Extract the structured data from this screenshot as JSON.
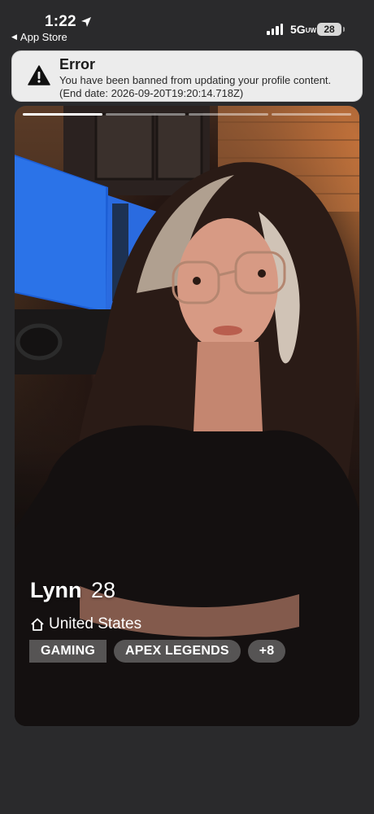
{
  "status_bar": {
    "time": "1:22",
    "back_app": "App Store",
    "network": "5G",
    "network_sub": "UW",
    "battery": "28"
  },
  "toast": {
    "title": "Error",
    "message": "You have been banned from updating your profile content. (End date: 2026-09-20T19:20:14.718Z)"
  },
  "profile": {
    "name": "Lynn",
    "age": "28",
    "location": "United States",
    "photo_count": 4,
    "active_photo": 1,
    "tags": [
      {
        "label": "GAMING"
      },
      {
        "label": "APEX LEGENDS"
      },
      {
        "label": "+8"
      }
    ]
  },
  "icons": {
    "location_arrow": "location-arrow-icon",
    "warning": "warning-icon",
    "home": "home-icon"
  }
}
